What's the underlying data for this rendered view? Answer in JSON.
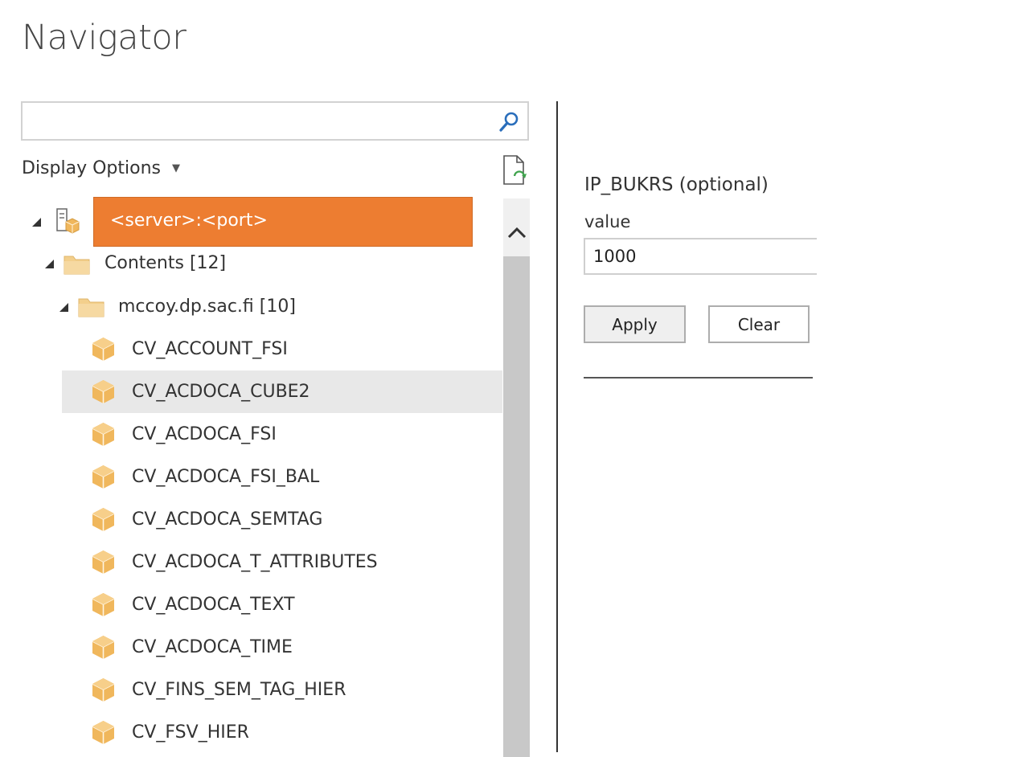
{
  "window": {
    "title": "Navigator"
  },
  "search": {
    "value": "",
    "placeholder": ""
  },
  "toolbar": {
    "display_options_label": "Display Options"
  },
  "tree": {
    "server": {
      "label": "<server>:<port>"
    },
    "contents": {
      "label": "Contents [12]"
    },
    "package": {
      "label": "mccoy.dp.sac.fi [10]"
    },
    "items": [
      {
        "label": "CV_ACCOUNT_FSI",
        "selected": false
      },
      {
        "label": "CV_ACDOCA_CUBE2",
        "selected": true
      },
      {
        "label": "CV_ACDOCA_FSI",
        "selected": false
      },
      {
        "label": "CV_ACDOCA_FSI_BAL",
        "selected": false
      },
      {
        "label": "CV_ACDOCA_SEMTAG",
        "selected": false
      },
      {
        "label": "CV_ACDOCA_T_ATTRIBUTES",
        "selected": false
      },
      {
        "label": "CV_ACDOCA_TEXT",
        "selected": false
      },
      {
        "label": "CV_ACDOCA_TIME",
        "selected": false
      },
      {
        "label": "CV_FINS_SEM_TAG_HIER",
        "selected": false
      },
      {
        "label": "CV_FSV_HIER",
        "selected": false
      }
    ]
  },
  "parameter": {
    "name": "IP_BUKRS (optional)",
    "value_label": "value",
    "value": "1000",
    "apply_label": "Apply",
    "clear_label": "Clear"
  },
  "colors": {
    "selection_accent": "#ed7d31",
    "row_hover": "#e8e8e8",
    "cube_icon": "#f0b75c",
    "folder_icon": "#f3cf8c",
    "search_icon": "#2a6ebb"
  },
  "icons": {
    "search": "search-icon",
    "refresh": "refresh-document-icon",
    "server": "server-icon",
    "folder": "folder-icon",
    "cube": "cube-icon",
    "scroll_up": "chevron-up-icon",
    "dropdown": "caret-down-icon"
  }
}
